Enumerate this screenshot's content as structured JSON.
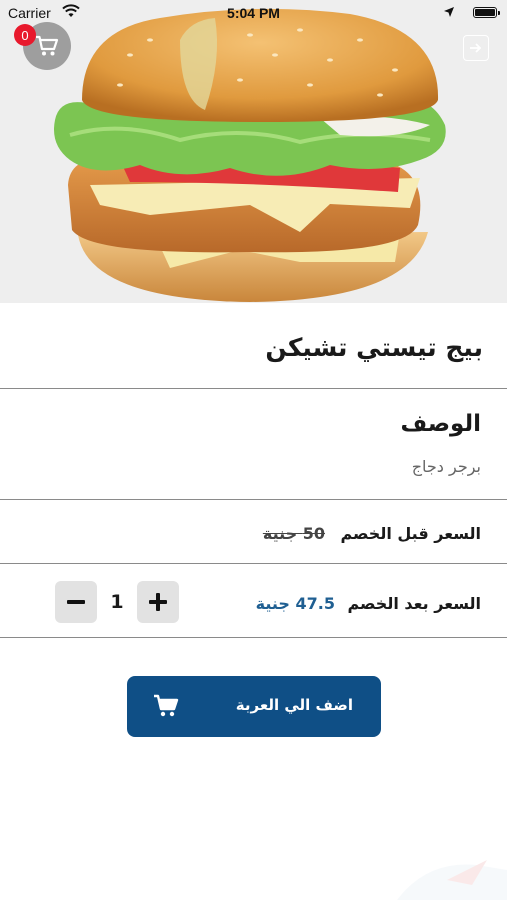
{
  "status_bar": {
    "carrier": "Carrier",
    "time": "5:04 PM"
  },
  "cart": {
    "badge_count": "0"
  },
  "product": {
    "name": "بيج تيستي تشيكن",
    "description_heading": "الوصف",
    "description": "برجر دجاج",
    "price_before_label": "السعر قبل الخصم",
    "price_before_value": "50 جنية",
    "price_after_label": "السعر بعد الخصم",
    "price_after_value": "47.5 جنية"
  },
  "quantity": {
    "value": "1"
  },
  "add_to_cart": {
    "label": "اضف الي العربة"
  },
  "colors": {
    "primary": "#0f4f86",
    "price_accent": "#1f5f92",
    "badge": "#e8192c"
  }
}
